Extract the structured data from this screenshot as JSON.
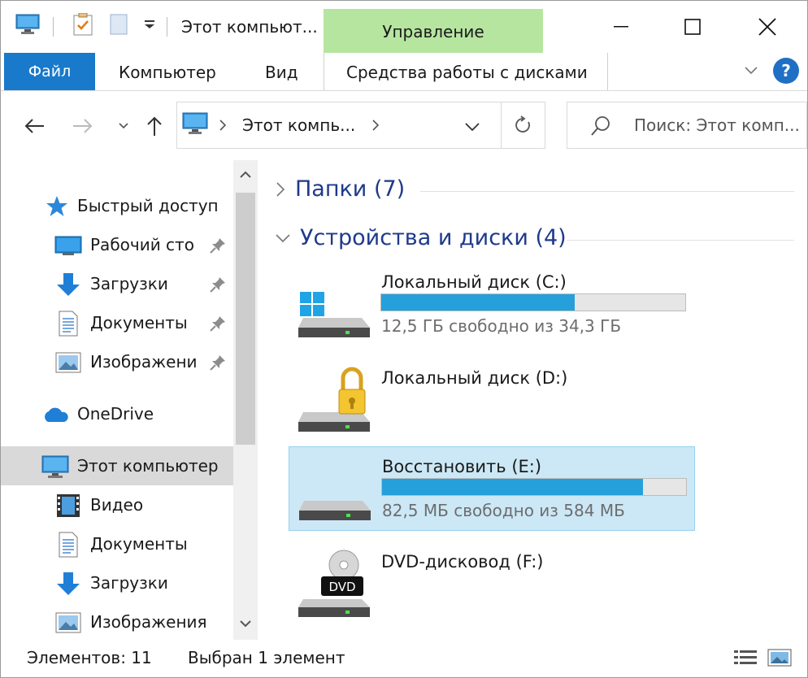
{
  "window": {
    "title": "Этот компьют...",
    "context_tab": "Управление",
    "colors": {
      "file_tab": "#1979ca",
      "context_tab": "#b6e5a0",
      "progress": "#26a0da",
      "selection": "#cce8f6",
      "group_header": "#1e3a8a"
    }
  },
  "ribbon": {
    "file": "Файл",
    "computer": "Компьютер",
    "view": "Вид",
    "disk_tools": "Средства работы с дисками",
    "help": "?"
  },
  "navbar": {
    "address": "Этот компь...",
    "search_placeholder": "Поиск: Этот комп..."
  },
  "sidebar": {
    "quick_access": "Быстрый доступ",
    "desktop": "Рабочий сто",
    "downloads_pinned": "Загрузки",
    "documents_pinned": "Документы",
    "pictures_pinned": "Изображени",
    "onedrive": "OneDrive",
    "this_pc": "Этот компьютер",
    "video": "Видео",
    "documents": "Документы",
    "downloads": "Загрузки",
    "pictures": "Изображения"
  },
  "main": {
    "folders_group": "Папки (7)",
    "devices_group": "Устройства и диски (4)",
    "drives": [
      {
        "name": "Локальный диск (C:)",
        "free": "12,5 ГБ свободно из 34,3 ГБ",
        "used_fraction": 0.636
      },
      {
        "name": "Локальный диск (D:)"
      },
      {
        "name": "Восстановить (E:)",
        "free": "82,5 МБ свободно из 584 МБ",
        "used_fraction": 0.859
      },
      {
        "name": "DVD-дисковод (F:)",
        "badge": "DVD"
      }
    ]
  },
  "status": {
    "items": "Элементов: 11",
    "selected": "Выбран 1 элемент"
  }
}
